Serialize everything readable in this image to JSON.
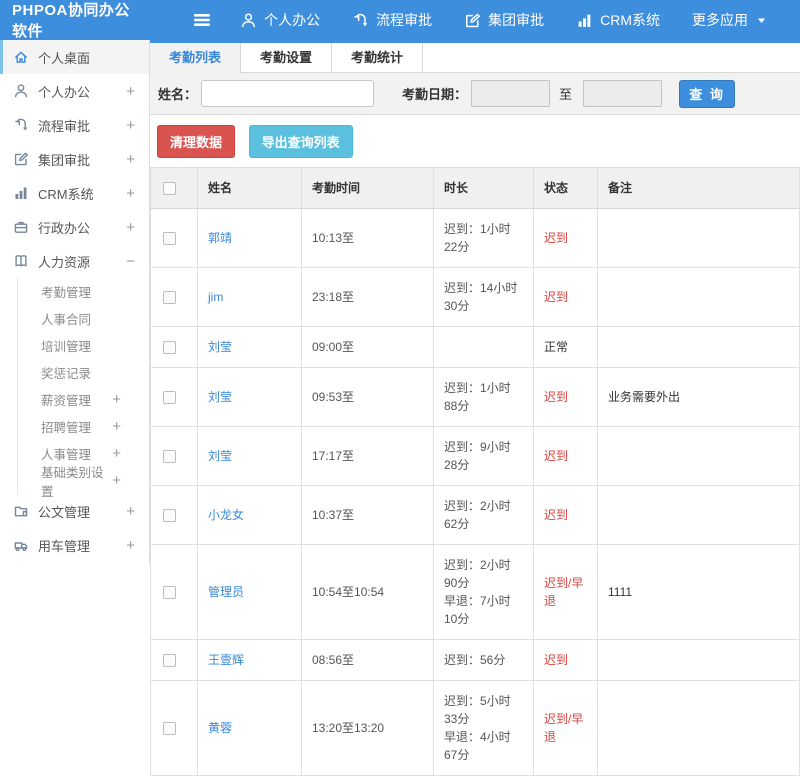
{
  "topbar": {
    "brand": "PHPOA协同办公软件",
    "nav": [
      {
        "label": "个人办公",
        "icon": "user-icon"
      },
      {
        "label": "流程审批",
        "icon": "workflow-icon"
      },
      {
        "label": "集团审批",
        "icon": "edit-icon"
      },
      {
        "label": "CRM系统",
        "icon": "chart-icon"
      },
      {
        "label": "更多应用",
        "icon": "caret-down-icon",
        "caret": true
      }
    ]
  },
  "sidebar": {
    "items": [
      {
        "label": "个人桌面",
        "icon": "home-icon",
        "active": true
      },
      {
        "label": "个人办公",
        "icon": "user-icon",
        "expand": "+"
      },
      {
        "label": "流程审批",
        "icon": "workflow-icon",
        "expand": "+"
      },
      {
        "label": "集团审批",
        "icon": "edit-icon",
        "expand": "+"
      },
      {
        "label": "CRM系统",
        "icon": "chart-icon",
        "expand": "+"
      },
      {
        "label": "行政办公",
        "icon": "briefcase-icon",
        "expand": "+"
      },
      {
        "label": "人力资源",
        "icon": "book-icon",
        "expand": "−"
      },
      {
        "label": "考勤管理",
        "sub": true
      },
      {
        "label": "人事合同",
        "sub": true
      },
      {
        "label": "培训管理",
        "sub": true
      },
      {
        "label": "奖惩记录",
        "sub": true
      },
      {
        "label": "薪资管理",
        "sub": true,
        "expand": "+"
      },
      {
        "label": "招聘管理",
        "sub": true,
        "expand": "+"
      },
      {
        "label": "人事管理",
        "sub": true,
        "expand": "+"
      },
      {
        "label": "基础类别设置",
        "sub": true,
        "expand": "+"
      },
      {
        "label": "公文管理",
        "icon": "doc-icon",
        "expand": "+"
      },
      {
        "label": "用车管理",
        "icon": "car-icon",
        "expand": "+"
      }
    ]
  },
  "tabs": [
    {
      "label": "考勤列表",
      "active": true
    },
    {
      "label": "考勤设置",
      "active": false
    },
    {
      "label": "考勤统计",
      "active": false
    }
  ],
  "filters": {
    "name_label": "姓名：",
    "name_value": "",
    "date_label": "考勤日期：",
    "date_from_value": "",
    "to_label": "至",
    "date_to_value": "",
    "search_button": "查 询"
  },
  "actions": {
    "clean_button": "清理数据",
    "export_button": "导出查询列表"
  },
  "table": {
    "headers": [
      "姓名",
      "考勤时间",
      "时长",
      "状态",
      "备注"
    ],
    "rows": [
      {
        "name": "郭靖",
        "time": "10:13至",
        "duration": [
          "迟到：1小时22分"
        ],
        "status": "迟到",
        "status_red": true,
        "remark": ""
      },
      {
        "name": "jim",
        "time": "23:18至",
        "duration": [
          "迟到：14小时30分"
        ],
        "status": "迟到",
        "status_red": true,
        "remark": ""
      },
      {
        "name": "刘莹",
        "time": "09:00至",
        "duration": [],
        "status": "正常",
        "status_red": false,
        "remark": ""
      },
      {
        "name": "刘莹",
        "time": "09:53至",
        "duration": [
          "迟到：1小时88分"
        ],
        "status": "迟到",
        "status_red": true,
        "remark": "业务需要外出"
      },
      {
        "name": "刘莹",
        "time": "17:17至",
        "duration": [
          "迟到：9小时28分"
        ],
        "status": "迟到",
        "status_red": true,
        "remark": ""
      },
      {
        "name": "小龙女",
        "time": "10:37至",
        "duration": [
          "迟到：2小时62分"
        ],
        "status": "迟到",
        "status_red": true,
        "remark": ""
      },
      {
        "name": "管理员",
        "time": "10:54至10:54",
        "duration": [
          "迟到：2小时90分",
          "早退：7小时10分"
        ],
        "status": "迟到/早退",
        "status_red": true,
        "remark": "1111"
      },
      {
        "name": "王壹辉",
        "time": "08:56至",
        "duration": [
          "迟到：56分"
        ],
        "status": "迟到",
        "status_red": true,
        "remark": ""
      },
      {
        "name": "黄蓉",
        "time": "13:20至13:20",
        "duration": [
          "迟到：5小时33分",
          "早退：4小时67分"
        ],
        "status": "迟到/早退",
        "status_red": true,
        "remark": ""
      }
    ]
  },
  "colors": {
    "topbar_blue": "#3e8ede",
    "link_blue": "#3a87d8",
    "status_red": "#d9423d",
    "danger_red": "#d9534f",
    "info_cyan": "#5bc0de"
  }
}
